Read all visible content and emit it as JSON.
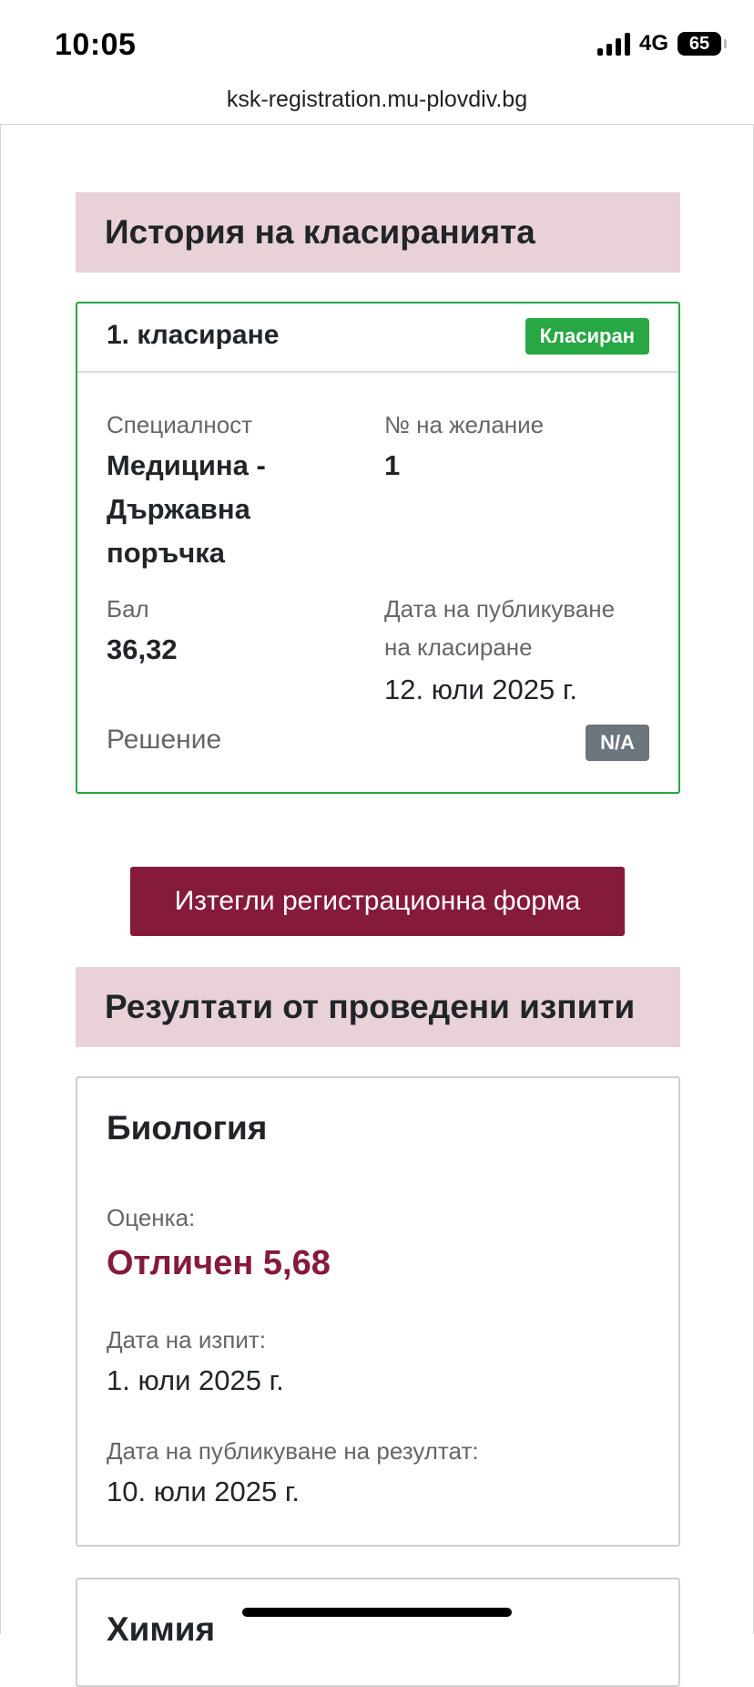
{
  "status_bar": {
    "time": "10:05",
    "network": "4G",
    "battery": "65"
  },
  "browser": {
    "url": "ksk-registration.mu-plovdiv.bg"
  },
  "ranking_history": {
    "heading": "История на класиранията",
    "card": {
      "title": "1. класиране",
      "status_badge": "Класиран",
      "status_color": "#28a745",
      "specialty_label": "Специалност",
      "specialty_value_lines": [
        "Медицина -",
        "Държавна",
        "поръчка"
      ],
      "wish_label": "№ на желание",
      "wish_value": "1",
      "score_label": "Бал",
      "score_value": "36,32",
      "publish_label_lines": [
        "Дата на публикуване",
        "на класиране"
      ],
      "publish_value": "12. юли 2025 г.",
      "decision_label": "Решение",
      "decision_badge": "N/A"
    }
  },
  "download_button": {
    "label": "Изтегли регистрационна форма",
    "color": "#861a3b"
  },
  "exam_results": {
    "heading": "Резултати от проведени изпити",
    "exams": [
      {
        "subject": "Биология",
        "grade_label": "Оценка:",
        "grade_value": "Отличен 5,68",
        "exam_date_label": "Дата на изпит:",
        "exam_date_value": "1. юли 2025 г.",
        "publish_date_label": "Дата на публикуване на резултат:",
        "publish_date_value": "10. юли 2025 г."
      },
      {
        "subject": "Химия"
      }
    ]
  }
}
